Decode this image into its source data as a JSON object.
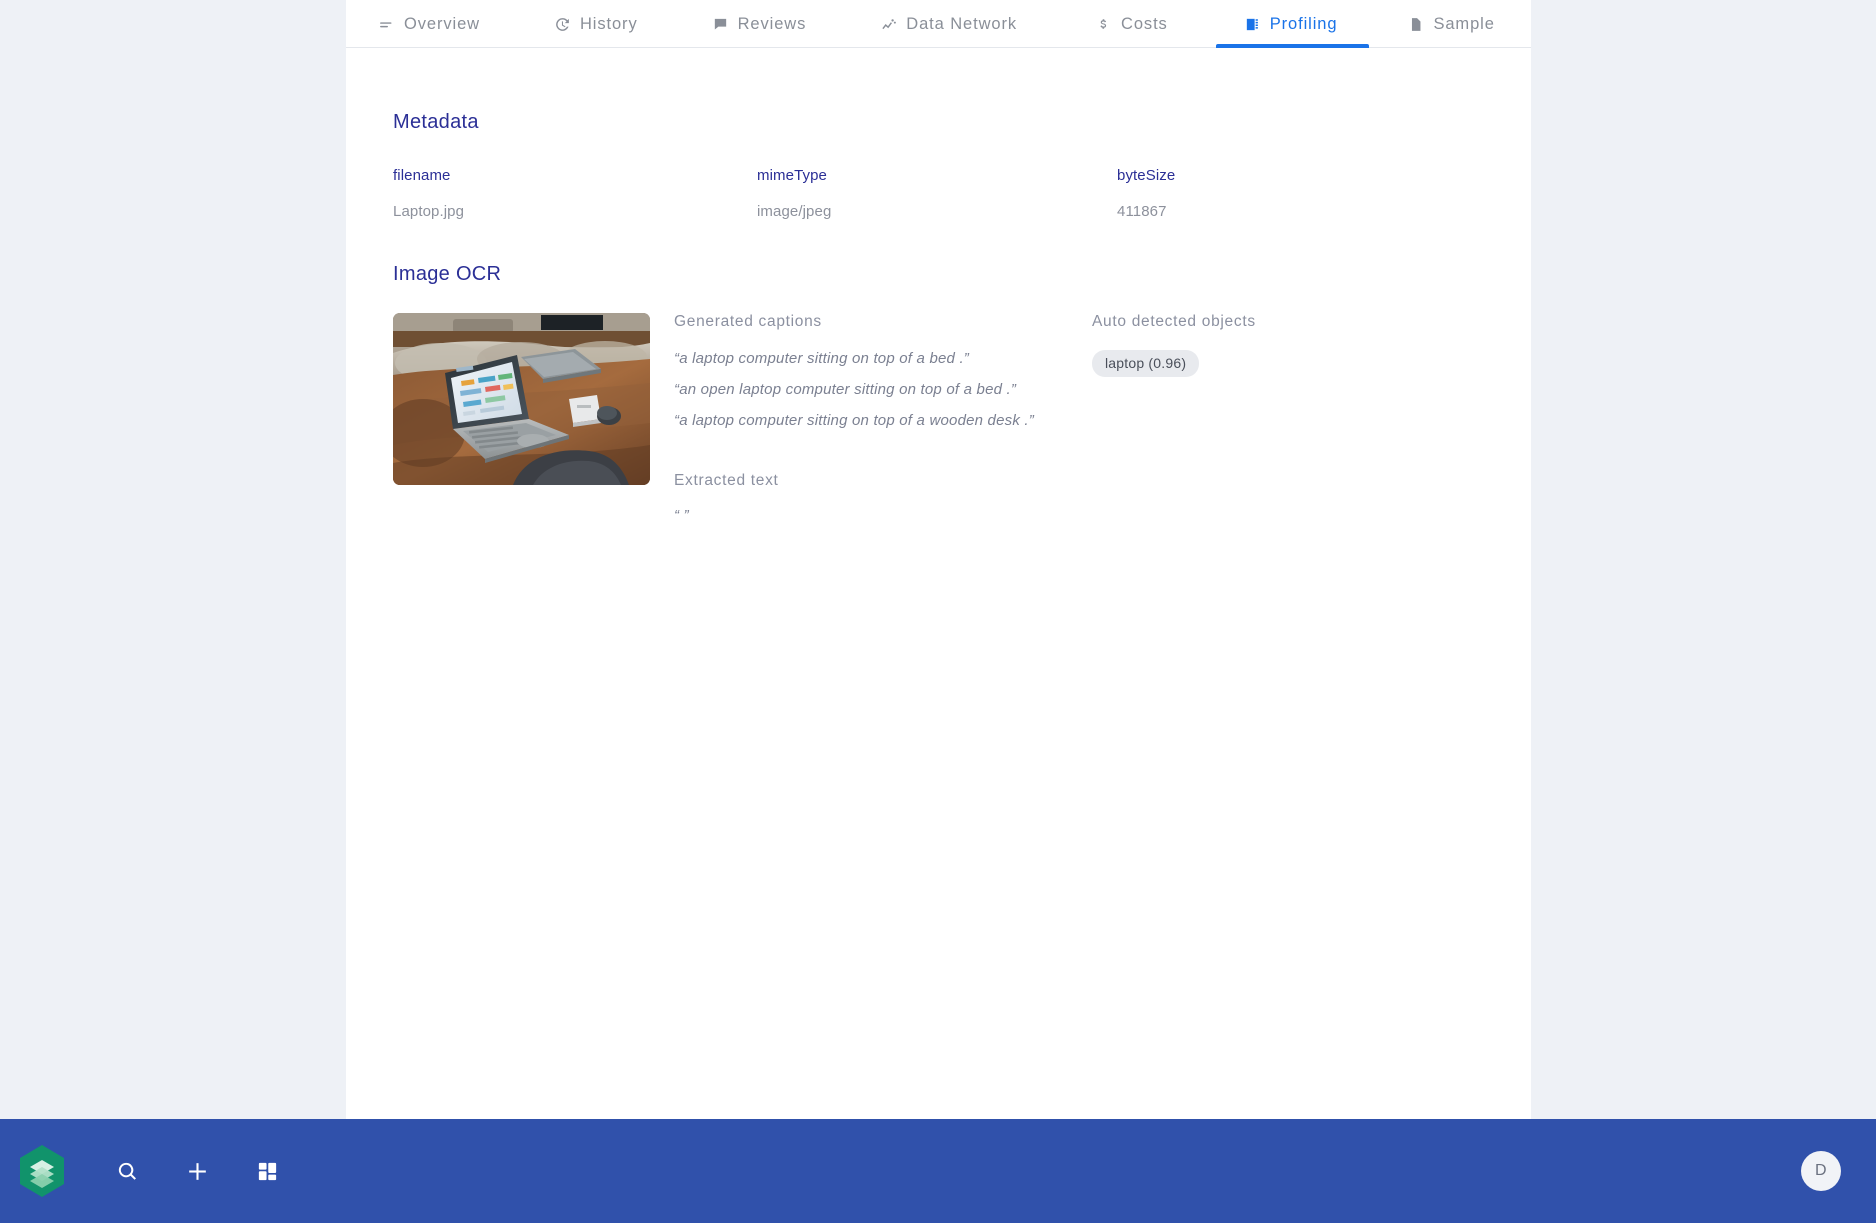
{
  "colors": {
    "page_background": "#eef1f6",
    "panel_background": "#ffffff",
    "accent_blue": "#1a73e8",
    "heading_indigo": "#2b2f96",
    "bottom_bar": "#3051ab",
    "chip_background": "#e8eaee",
    "muted_text": "#8d919c"
  },
  "tabs": [
    {
      "label": "Overview",
      "icon": "list-lines-icon",
      "active": false
    },
    {
      "label": "History",
      "icon": "clock-history-icon",
      "active": false
    },
    {
      "label": "Reviews",
      "icon": "speech-bubble-icon",
      "active": false
    },
    {
      "label": "Data Network",
      "icon": "trending-chart-icon",
      "active": false
    },
    {
      "label": "Costs",
      "icon": "dollar-sign-icon",
      "active": false
    },
    {
      "label": "Profiling",
      "icon": "profiling-card-icon",
      "active": true
    },
    {
      "label": "Sample",
      "icon": "document-icon",
      "active": false
    }
  ],
  "metadata": {
    "section_title": "Metadata",
    "fields": [
      {
        "key": "filename",
        "value": "Laptop.jpg"
      },
      {
        "key": "mimeType",
        "value": "image/jpeg"
      },
      {
        "key": "byteSize",
        "value": "411867"
      }
    ]
  },
  "image_ocr": {
    "section_title": "Image OCR",
    "thumbnail_alt": "laptop-on-leather-couch-thumbnail",
    "captions_label": "Generated captions",
    "captions": [
      "“a laptop computer sitting on top of a bed .”",
      "“an open laptop computer sitting on top of a bed .”",
      "“a laptop computer sitting on top of a wooden desk .”"
    ],
    "extracted_text_label": "Extracted text",
    "extracted_text": "“ ”",
    "objects_label": "Auto detected objects",
    "objects": [
      {
        "label": "laptop (0.96)"
      }
    ]
  },
  "bottom_bar": {
    "logo": "stacked-layers-logo",
    "actions": [
      {
        "icon": "search-icon"
      },
      {
        "icon": "plus-icon"
      },
      {
        "icon": "grid-icon"
      }
    ],
    "avatar_initial": "D"
  }
}
